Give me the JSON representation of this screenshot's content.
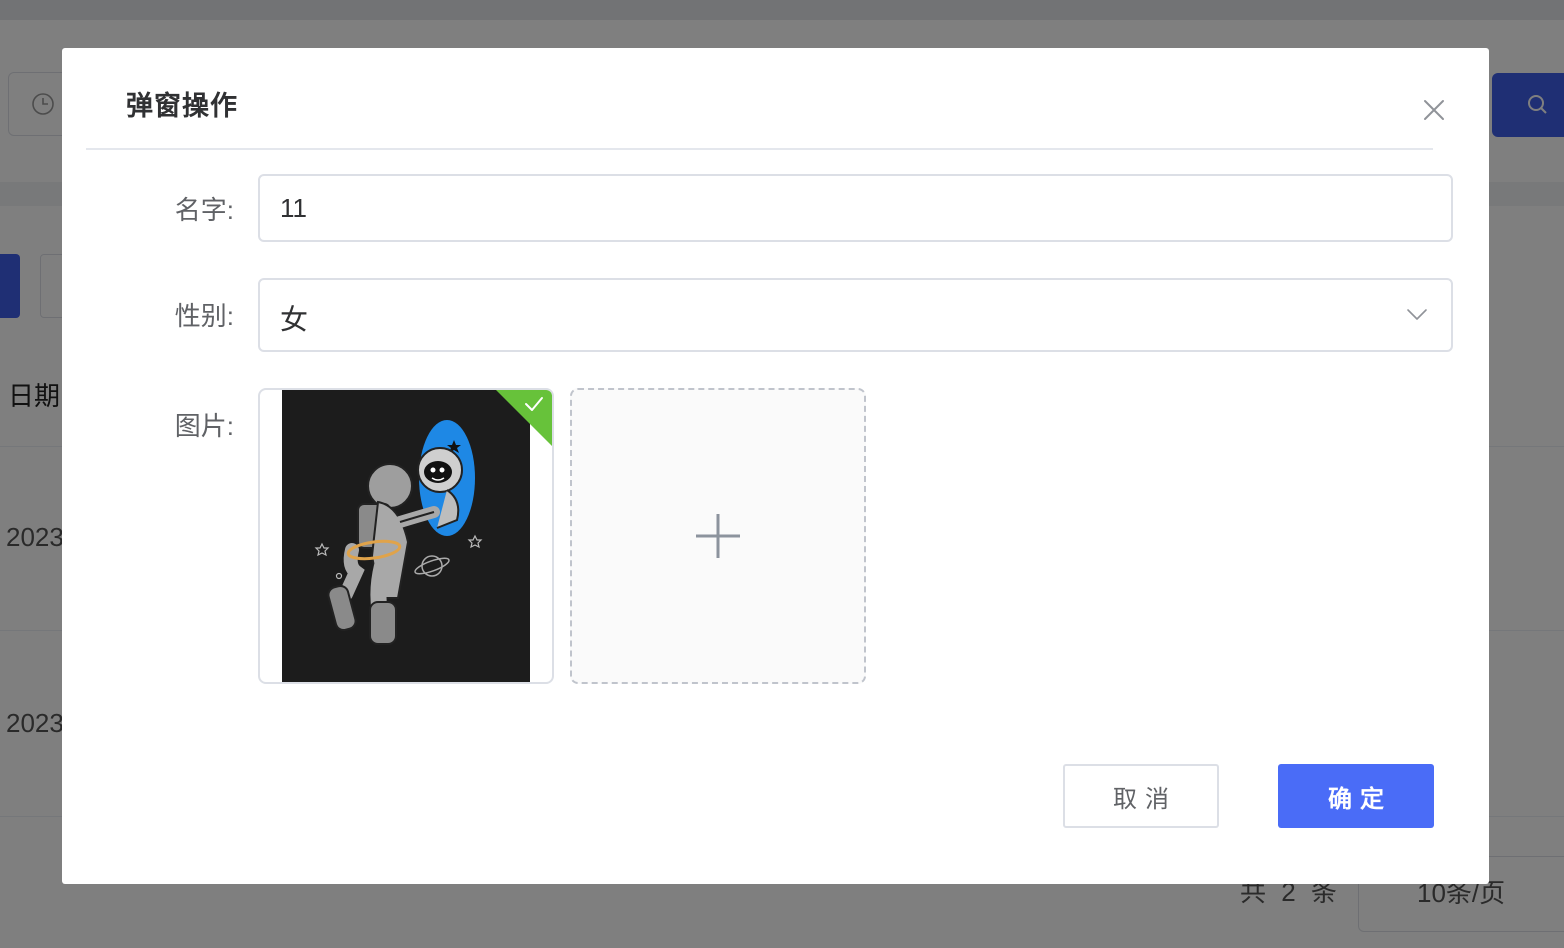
{
  "background": {
    "table_header_date": "日期",
    "rows": [
      "2023",
      "2023"
    ],
    "pagination": {
      "total": "共 2 条",
      "page_size": "10条/页"
    }
  },
  "dialog": {
    "title": "弹窗操作",
    "form": {
      "name_label": "名字:",
      "name_value": "11",
      "gender_label": "性别:",
      "gender_value": "女",
      "image_label": "图片:"
    },
    "buttons": {
      "cancel": "取消",
      "confirm": "确定"
    }
  },
  "colors": {
    "primary": "#4a6cf7",
    "success": "#67c23a",
    "portal_blue": "#1e88e5"
  },
  "icons": [
    "clock-icon",
    "search-icon",
    "close-icon",
    "chevron-down-icon",
    "success-check-icon",
    "plus-icon"
  ]
}
